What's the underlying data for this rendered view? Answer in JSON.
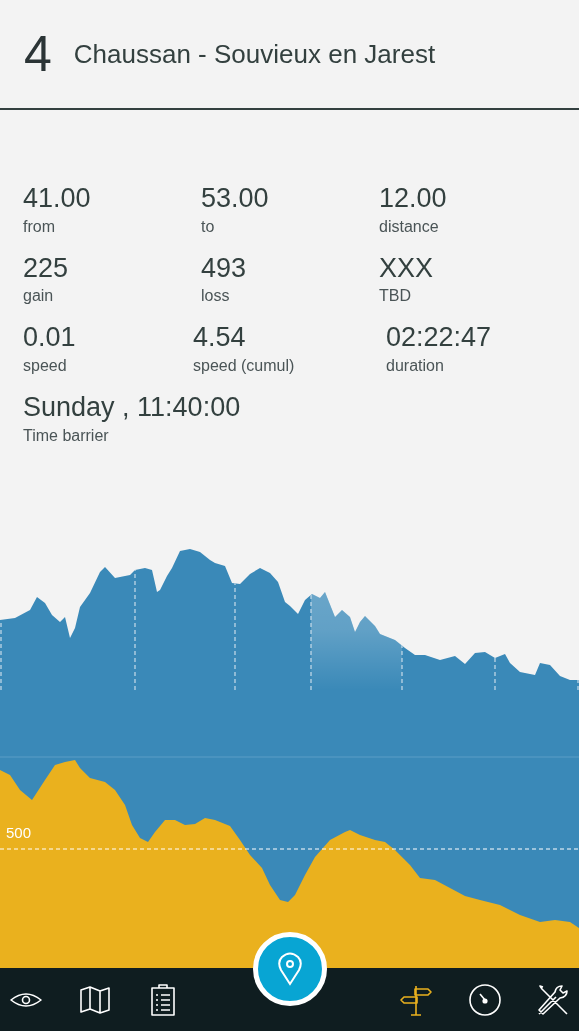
{
  "header": {
    "number": "4",
    "title": "Chaussan - Souvieux en Jarest"
  },
  "stats": [
    [
      {
        "value": "41.00",
        "label": "from"
      },
      {
        "value": "53.00",
        "label": "to"
      },
      {
        "value": "12.00",
        "label": "distance"
      }
    ],
    [
      {
        "value": "225",
        "label": "gain"
      },
      {
        "value": "493",
        "label": "loss"
      },
      {
        "value": "XXX",
        "label": "TBD"
      }
    ],
    [
      {
        "value": "0.01",
        "label": "speed"
      },
      {
        "value": "4.54",
        "label": "speed (cumul)"
      },
      {
        "value": "02:22:47",
        "label": "duration"
      }
    ]
  ],
  "time_barrier": {
    "value": "Sunday , 11:40:00",
    "label": "Time barrier"
  },
  "chart": {
    "reference_label": "500"
  },
  "nav": [
    {
      "selected": false
    },
    {
      "selected": false
    },
    {
      "selected": false
    },
    {
      "selected": true
    },
    {
      "selected": false
    },
    {
      "selected": false
    }
  ]
}
